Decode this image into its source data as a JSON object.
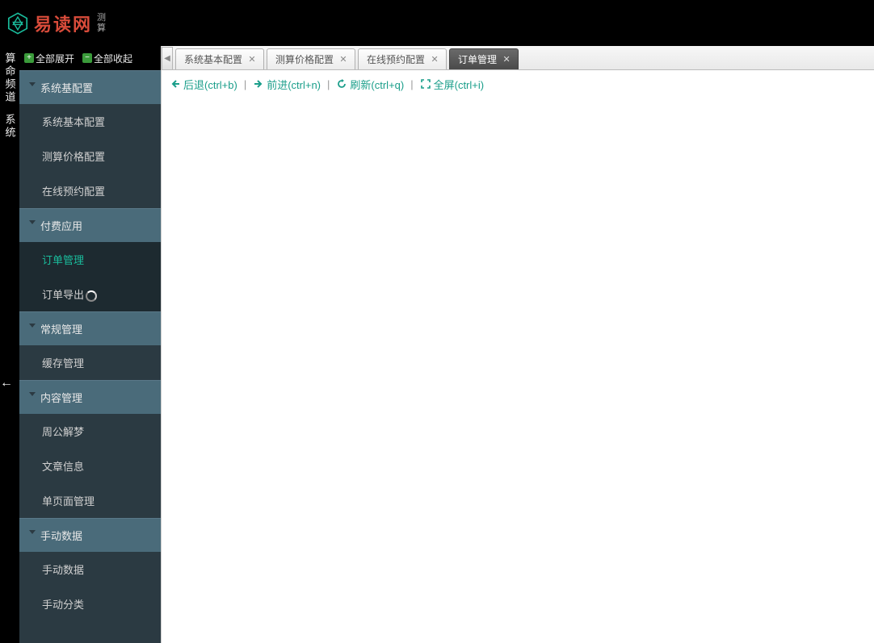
{
  "header": {
    "logo_text": "易读网",
    "logo_sub1": "测",
    "logo_sub2": "算"
  },
  "vertical_nav": {
    "item1": "算命频道",
    "item2": "系统"
  },
  "sidebar_toolbar": {
    "expand": "全部展开",
    "collapse": "全部收起"
  },
  "menu": {
    "groups": [
      {
        "label": "系统基配置",
        "items": [
          {
            "label": "系统基本配置"
          },
          {
            "label": "测算价格配置"
          },
          {
            "label": "在线预约配置"
          }
        ]
      },
      {
        "label": "付费应用",
        "items": [
          {
            "label": "订单管理",
            "active": true
          },
          {
            "label": "订单导出",
            "loading": true
          }
        ]
      },
      {
        "label": "常规管理",
        "items": [
          {
            "label": "缓存管理"
          }
        ]
      },
      {
        "label": "内容管理",
        "items": [
          {
            "label": "周公解梦"
          },
          {
            "label": "文章信息"
          },
          {
            "label": "单页面管理"
          }
        ]
      },
      {
        "label": "手动数据",
        "items": [
          {
            "label": "手动数据"
          },
          {
            "label": "手动分类"
          }
        ]
      }
    ]
  },
  "tabs": [
    {
      "label": "系统基本配置",
      "active": false
    },
    {
      "label": "测算价格配置",
      "active": false
    },
    {
      "label": "在线预约配置",
      "active": false
    },
    {
      "label": "订单管理",
      "active": true
    }
  ],
  "actions": {
    "back": "后退(ctrl+b)",
    "forward": "前进(ctrl+n)",
    "refresh": "刷新(ctrl+q)",
    "fullscreen": "全屏(ctrl+i)"
  }
}
